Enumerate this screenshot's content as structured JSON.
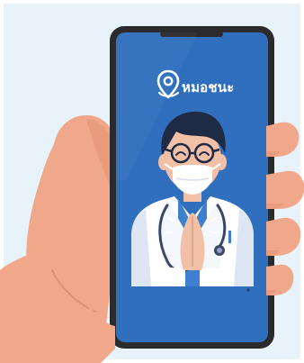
{
  "app": {
    "brand_name": "หมอชนะ"
  },
  "illustration": {
    "subject": "hand-holding-phone",
    "screen_content": "doctor-wai-greeting",
    "icons": [
      "location-pin-logo-icon",
      "stethoscope-icon",
      "glasses-icon",
      "face-mask-icon"
    ]
  },
  "colors": {
    "background": "#e8f2f9",
    "phone_frame": "#2b2b2d",
    "screen": "#2f6fbe",
    "skin": "#f1a88a",
    "skin_shadow": "#e08f72",
    "doctor_hair": "#1f2a44",
    "doctor_coat": "#ffffff",
    "doctor_shirt": "#3e7fd0",
    "stethoscope": "#3a4766",
    "mask": "#ffffff"
  }
}
